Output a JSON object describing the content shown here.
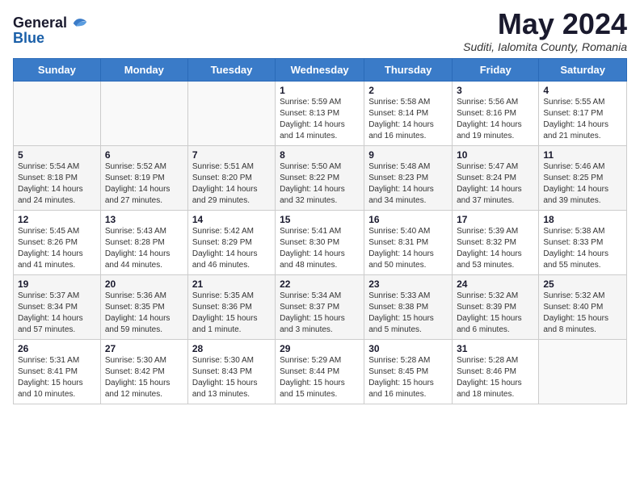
{
  "header": {
    "logo_general": "General",
    "logo_blue": "Blue",
    "month_title": "May 2024",
    "subtitle": "Suditi, Ialomita County, Romania"
  },
  "weekdays": [
    "Sunday",
    "Monday",
    "Tuesday",
    "Wednesday",
    "Thursday",
    "Friday",
    "Saturday"
  ],
  "weeks": [
    [
      {
        "day": "",
        "info": ""
      },
      {
        "day": "",
        "info": ""
      },
      {
        "day": "",
        "info": ""
      },
      {
        "day": "1",
        "info": "Sunrise: 5:59 AM\nSunset: 8:13 PM\nDaylight: 14 hours\nand 14 minutes."
      },
      {
        "day": "2",
        "info": "Sunrise: 5:58 AM\nSunset: 8:14 PM\nDaylight: 14 hours\nand 16 minutes."
      },
      {
        "day": "3",
        "info": "Sunrise: 5:56 AM\nSunset: 8:16 PM\nDaylight: 14 hours\nand 19 minutes."
      },
      {
        "day": "4",
        "info": "Sunrise: 5:55 AM\nSunset: 8:17 PM\nDaylight: 14 hours\nand 21 minutes."
      }
    ],
    [
      {
        "day": "5",
        "info": "Sunrise: 5:54 AM\nSunset: 8:18 PM\nDaylight: 14 hours\nand 24 minutes."
      },
      {
        "day": "6",
        "info": "Sunrise: 5:52 AM\nSunset: 8:19 PM\nDaylight: 14 hours\nand 27 minutes."
      },
      {
        "day": "7",
        "info": "Sunrise: 5:51 AM\nSunset: 8:20 PM\nDaylight: 14 hours\nand 29 minutes."
      },
      {
        "day": "8",
        "info": "Sunrise: 5:50 AM\nSunset: 8:22 PM\nDaylight: 14 hours\nand 32 minutes."
      },
      {
        "day": "9",
        "info": "Sunrise: 5:48 AM\nSunset: 8:23 PM\nDaylight: 14 hours\nand 34 minutes."
      },
      {
        "day": "10",
        "info": "Sunrise: 5:47 AM\nSunset: 8:24 PM\nDaylight: 14 hours\nand 37 minutes."
      },
      {
        "day": "11",
        "info": "Sunrise: 5:46 AM\nSunset: 8:25 PM\nDaylight: 14 hours\nand 39 minutes."
      }
    ],
    [
      {
        "day": "12",
        "info": "Sunrise: 5:45 AM\nSunset: 8:26 PM\nDaylight: 14 hours\nand 41 minutes."
      },
      {
        "day": "13",
        "info": "Sunrise: 5:43 AM\nSunset: 8:28 PM\nDaylight: 14 hours\nand 44 minutes."
      },
      {
        "day": "14",
        "info": "Sunrise: 5:42 AM\nSunset: 8:29 PM\nDaylight: 14 hours\nand 46 minutes."
      },
      {
        "day": "15",
        "info": "Sunrise: 5:41 AM\nSunset: 8:30 PM\nDaylight: 14 hours\nand 48 minutes."
      },
      {
        "day": "16",
        "info": "Sunrise: 5:40 AM\nSunset: 8:31 PM\nDaylight: 14 hours\nand 50 minutes."
      },
      {
        "day": "17",
        "info": "Sunrise: 5:39 AM\nSunset: 8:32 PM\nDaylight: 14 hours\nand 53 minutes."
      },
      {
        "day": "18",
        "info": "Sunrise: 5:38 AM\nSunset: 8:33 PM\nDaylight: 14 hours\nand 55 minutes."
      }
    ],
    [
      {
        "day": "19",
        "info": "Sunrise: 5:37 AM\nSunset: 8:34 PM\nDaylight: 14 hours\nand 57 minutes."
      },
      {
        "day": "20",
        "info": "Sunrise: 5:36 AM\nSunset: 8:35 PM\nDaylight: 14 hours\nand 59 minutes."
      },
      {
        "day": "21",
        "info": "Sunrise: 5:35 AM\nSunset: 8:36 PM\nDaylight: 15 hours\nand 1 minute."
      },
      {
        "day": "22",
        "info": "Sunrise: 5:34 AM\nSunset: 8:37 PM\nDaylight: 15 hours\nand 3 minutes."
      },
      {
        "day": "23",
        "info": "Sunrise: 5:33 AM\nSunset: 8:38 PM\nDaylight: 15 hours\nand 5 minutes."
      },
      {
        "day": "24",
        "info": "Sunrise: 5:32 AM\nSunset: 8:39 PM\nDaylight: 15 hours\nand 6 minutes."
      },
      {
        "day": "25",
        "info": "Sunrise: 5:32 AM\nSunset: 8:40 PM\nDaylight: 15 hours\nand 8 minutes."
      }
    ],
    [
      {
        "day": "26",
        "info": "Sunrise: 5:31 AM\nSunset: 8:41 PM\nDaylight: 15 hours\nand 10 minutes."
      },
      {
        "day": "27",
        "info": "Sunrise: 5:30 AM\nSunset: 8:42 PM\nDaylight: 15 hours\nand 12 minutes."
      },
      {
        "day": "28",
        "info": "Sunrise: 5:30 AM\nSunset: 8:43 PM\nDaylight: 15 hours\nand 13 minutes."
      },
      {
        "day": "29",
        "info": "Sunrise: 5:29 AM\nSunset: 8:44 PM\nDaylight: 15 hours\nand 15 minutes."
      },
      {
        "day": "30",
        "info": "Sunrise: 5:28 AM\nSunset: 8:45 PM\nDaylight: 15 hours\nand 16 minutes."
      },
      {
        "day": "31",
        "info": "Sunrise: 5:28 AM\nSunset: 8:46 PM\nDaylight: 15 hours\nand 18 minutes."
      },
      {
        "day": "",
        "info": ""
      }
    ]
  ]
}
